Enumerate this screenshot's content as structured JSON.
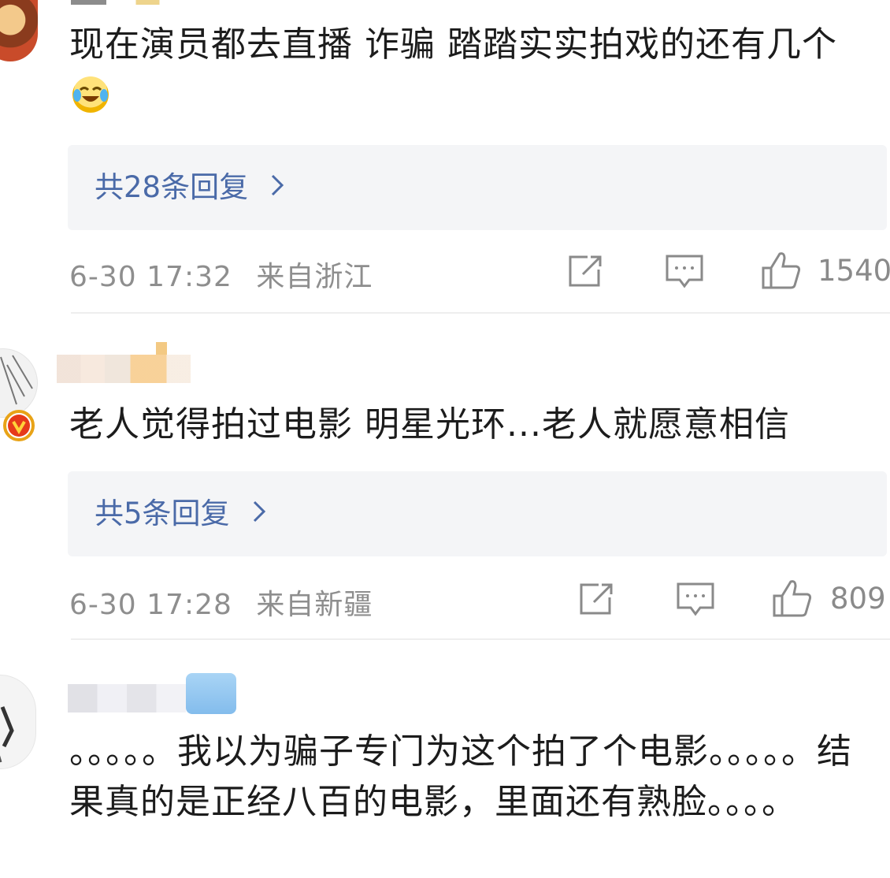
{
  "comments": [
    {
      "text": "现在演员都去直播 诈骗  踏踏实实拍戏的还有几个",
      "reply_label": "共28条回复",
      "date": "6-30 17:32",
      "location": "来自浙江",
      "likes": "1540"
    },
    {
      "text": "老人觉得拍过电影 明星光环...老人就愿意相信",
      "reply_label": "共5条回复",
      "date": "6-30 17:28",
      "location": "来自新疆",
      "likes": "809"
    },
    {
      "text": "。。。。。我以为骗子专门为这个拍了个电影。。。。。结果真的是正经八百的电影，里面还有熟脸。。。。"
    }
  ],
  "icons": {
    "emoji": "laughing-crying-emoji",
    "share": "share-icon",
    "comment": "comment-icon",
    "like": "thumbs-up-icon",
    "verified": "verified-v-badge",
    "chevron": "chevron-right-icon"
  },
  "colors": {
    "link": "#4a6aa8",
    "meta": "#8e8e8e",
    "reply_bg": "#f4f5f7",
    "verified_badge": "#e8a317"
  }
}
